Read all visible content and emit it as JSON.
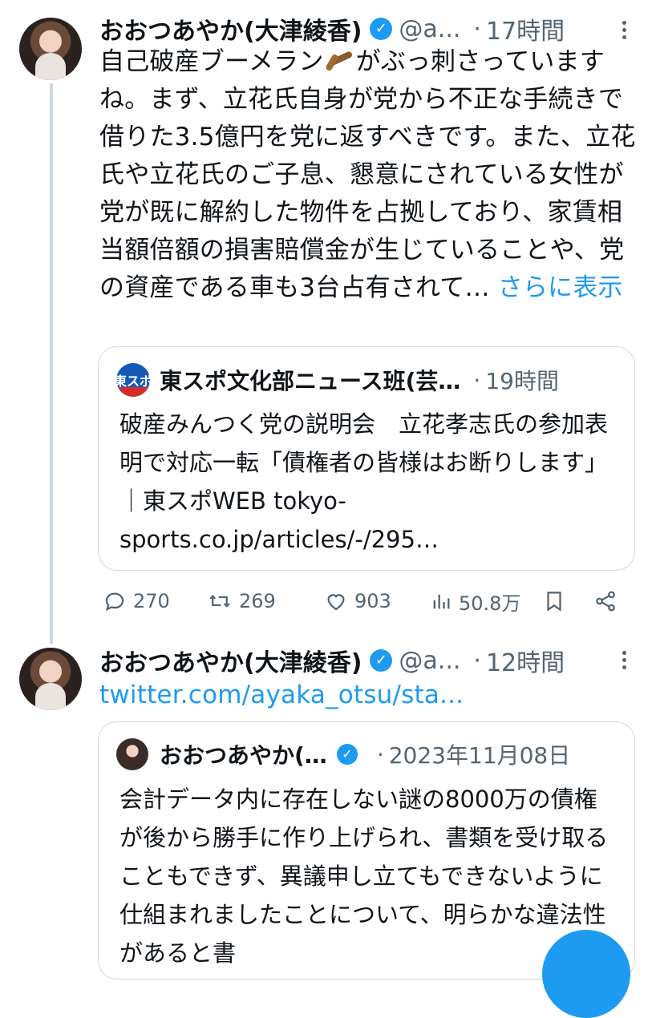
{
  "tweet1": {
    "author_name": "おおつあやか(大津綾香)",
    "handle": "@a...",
    "separator": "·",
    "time": "17時間",
    "text_before_emoji": "自己破産ブーメラン",
    "text_after_emoji": "がぶっ刺さっていますね。まず、立花氏自身が党から不正な手続きで借りた3.5億円を党に返すべきです。また、立花氏や立花氏のご子息、懇意にされている女性が党が既に解約した物件を占拠しており、家賃相当額倍額の損害賠償金が生じていることや、党の資産である車も3台占有されて…",
    "show_more": "さらに表示",
    "quote": {
      "author_name": "東スポ文化部ニュース班(芸…",
      "logo_text": "東スポ",
      "separator": "·",
      "time": "19時間",
      "text": "破産みんつく党の説明会　立花孝志氏の参加表明で対応一転「債権者の皆様はお断りします」｜東スポWEB tokyo-sports.co.jp/articles/-/295…"
    },
    "actions": {
      "replies": "270",
      "retweets": "269",
      "likes": "903",
      "views": "50.8万"
    }
  },
  "tweet2": {
    "author_name": "おおつあやか(大津綾香)",
    "handle": "@a...",
    "separator": "·",
    "time": "12時間",
    "link": "twitter.com/ayaka_otsu/sta...",
    "quote": {
      "author_name": "おおつあやか(…",
      "separator": "·",
      "time": "2023年11月08日",
      "text": "会計データ内に存在しない謎の8000万の債権が後から勝手に作り上げられ、書類を受け取ることもできず、異議申し立てもできないように仕組まれましたことについて、明らかな違法性があると書"
    }
  },
  "colors": {
    "accent": "#1d9bf0",
    "secondary_text": "#536471",
    "border": "#cfd9de"
  },
  "icons": [
    "reply-icon",
    "retweet-icon",
    "like-icon",
    "views-icon",
    "bookmark-icon",
    "share-icon",
    "verified-icon",
    "more-icon"
  ]
}
